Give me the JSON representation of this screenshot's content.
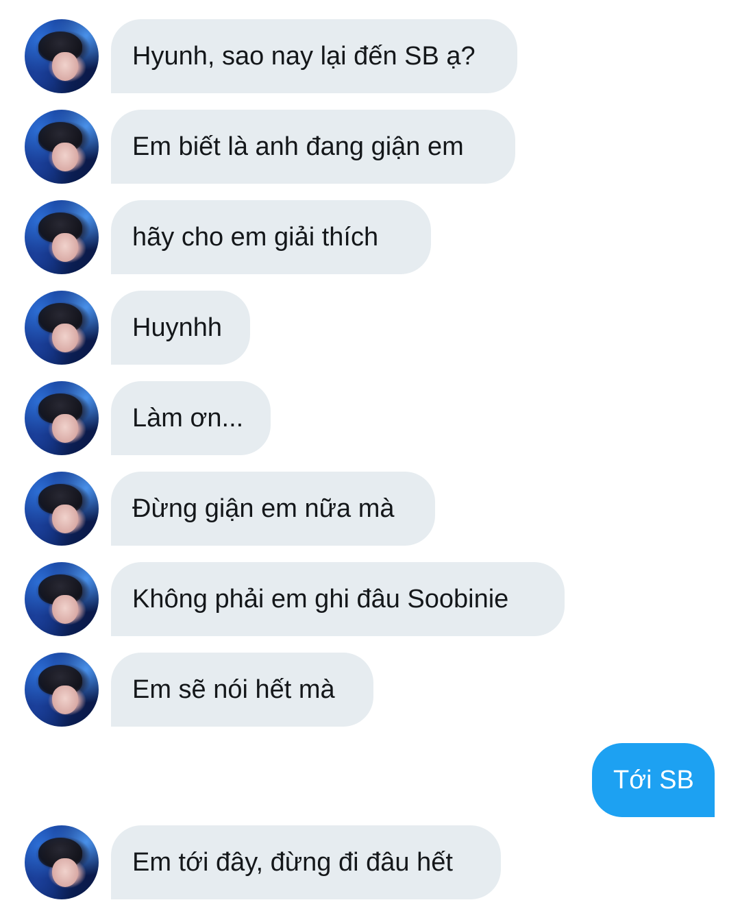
{
  "conversation": {
    "messages": [
      {
        "sender": "other",
        "text": "Hyunh, sao nay lại đến SB ạ?"
      },
      {
        "sender": "other",
        "text": "Em biết là anh đang giận em"
      },
      {
        "sender": "other",
        "text": "hãy cho em giải thích"
      },
      {
        "sender": "other",
        "text": "Huynhh"
      },
      {
        "sender": "other",
        "text": "Làm ơn..."
      },
      {
        "sender": "other",
        "text": "Đừng giận em nữa mà"
      },
      {
        "sender": "other",
        "text": "Không phải em ghi đâu Soobinie"
      },
      {
        "sender": "other",
        "text": "Em sẽ nói hết mà"
      },
      {
        "sender": "me",
        "text": "Tới SB"
      },
      {
        "sender": "other",
        "text": "Em tới đây, đừng đi đâu hết"
      }
    ]
  },
  "colors": {
    "incoming_bubble": "#e6ecf0",
    "outgoing_bubble": "#1da1f2",
    "incoming_text": "#14171a",
    "outgoing_text": "#ffffff"
  },
  "icons": {
    "avatar": "contact-avatar-photo"
  }
}
